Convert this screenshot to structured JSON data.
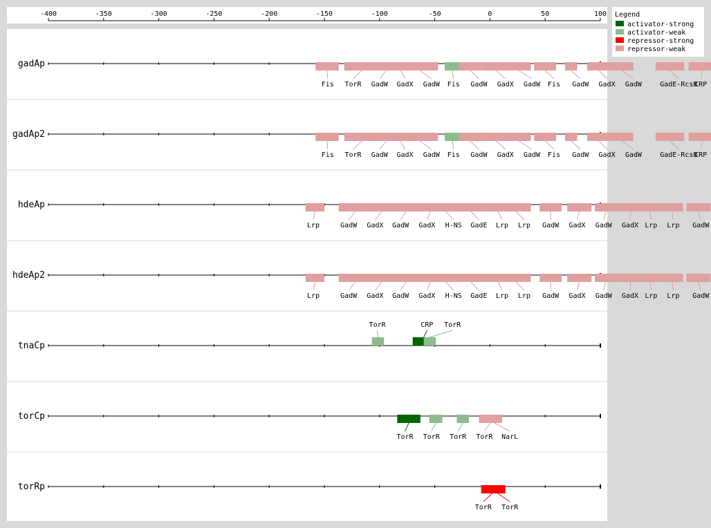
{
  "axis": {
    "min": -400,
    "max": 100,
    "ticks": [
      -400,
      -350,
      -300,
      -250,
      -200,
      -150,
      -100,
      -50,
      0,
      50,
      100
    ]
  },
  "legend": {
    "title": "Legend",
    "items": [
      {
        "label": "activator-strong",
        "color": "#006400"
      },
      {
        "label": "activator-weak",
        "color": "#8fbc8f"
      },
      {
        "label": "repressor-strong",
        "color": "#ff0000"
      },
      {
        "label": "repressor-weak",
        "color": "#e0a0a0"
      }
    ]
  },
  "colors": {
    "aw": "#8fbc8f",
    "as": "#006400",
    "rw": "#e0a0a0",
    "rs": "#ff0000"
  },
  "promoters": [
    {
      "name": "gadAp",
      "sites": [
        {
          "s": -158,
          "e": -137,
          "t": "rw",
          "l": "Fis",
          "p": -147
        },
        {
          "s": -132,
          "e": -100,
          "t": "rw",
          "l": "TorR",
          "p": -124
        },
        {
          "s": -103,
          "e": -85,
          "t": "rw",
          "l": "GadW",
          "p": -100
        },
        {
          "s": -92,
          "e": -70,
          "t": "rw",
          "l": "GadX",
          "p": -77
        },
        {
          "s": -80,
          "e": -47,
          "t": "rw",
          "l": "GadW",
          "p": -53
        },
        {
          "s": -41,
          "e": -27,
          "t": "aw",
          "l": "Fis",
          "p": -33
        },
        {
          "s": -28,
          "e": -8,
          "t": "rw",
          "l": "GadW",
          "p": -10
        },
        {
          "s": -8,
          "e": 19,
          "t": "rw",
          "l": "GadX",
          "p": 14
        },
        {
          "s": 15,
          "e": 37,
          "t": "rw",
          "l": "GadW",
          "p": 38
        },
        {
          "s": 40,
          "e": 60,
          "t": "rw",
          "l": "Fis",
          "p": 58
        },
        {
          "s": 68,
          "e": 79,
          "t": "rw",
          "l": "GadW",
          "p": 82
        },
        {
          "s": 88,
          "e": 110,
          "t": "rw",
          "l": "GadX",
          "p": 106
        },
        {
          "s": 110,
          "e": 130,
          "t": "rw",
          "l": "GadW",
          "p": 130
        },
        {
          "s": 150,
          "e": 176,
          "t": "rw",
          "l": "GadE-RcsB",
          "p": 171
        },
        {
          "s": 180,
          "e": 205,
          "t": "rw",
          "l": "CRP",
          "p": 191
        }
      ]
    },
    {
      "name": "gadAp2",
      "sites": [
        {
          "s": -158,
          "e": -137,
          "t": "rw",
          "l": "Fis",
          "p": -147
        },
        {
          "s": -132,
          "e": -100,
          "t": "rw",
          "l": "TorR",
          "p": -124
        },
        {
          "s": -103,
          "e": -85,
          "t": "rw",
          "l": "GadW",
          "p": -100
        },
        {
          "s": -92,
          "e": -70,
          "t": "rw",
          "l": "GadX",
          "p": -77
        },
        {
          "s": -80,
          "e": -47,
          "t": "rw",
          "l": "GadW",
          "p": -53
        },
        {
          "s": -41,
          "e": -27,
          "t": "aw",
          "l": "Fis",
          "p": -33
        },
        {
          "s": -28,
          "e": -8,
          "t": "rw",
          "l": "GadW",
          "p": -10
        },
        {
          "s": -8,
          "e": 19,
          "t": "rw",
          "l": "GadX",
          "p": 14
        },
        {
          "s": 15,
          "e": 37,
          "t": "rw",
          "l": "GadW",
          "p": 38
        },
        {
          "s": 40,
          "e": 60,
          "t": "rw",
          "l": "Fis",
          "p": 58
        },
        {
          "s": 68,
          "e": 79,
          "t": "rw",
          "l": "GadW",
          "p": 82
        },
        {
          "s": 88,
          "e": 110,
          "t": "rw",
          "l": "GadX",
          "p": 106
        },
        {
          "s": 110,
          "e": 130,
          "t": "rw",
          "l": "GadW",
          "p": 130
        },
        {
          "s": 150,
          "e": 176,
          "t": "rw",
          "l": "GadE-RcsB",
          "p": 171
        },
        {
          "s": 180,
          "e": 205,
          "t": "rw",
          "l": "CRP",
          "p": 191
        }
      ]
    },
    {
      "name": "hdeAp",
      "sites": [
        {
          "s": -167,
          "e": -150,
          "t": "rw",
          "l": "Lrp",
          "p": -160
        },
        {
          "s": -137,
          "e": -107,
          "t": "rw",
          "l": "GadW",
          "p": -128
        },
        {
          "s": -108,
          "e": -88,
          "t": "rw",
          "l": "GadX",
          "p": -104
        },
        {
          "s": -90,
          "e": -62,
          "t": "rw",
          "l": "GadW",
          "p": -81
        },
        {
          "s": -68,
          "e": -40,
          "t": "rw",
          "l": "GadX",
          "p": -57
        },
        {
          "s": -55,
          "e": -25,
          "t": "rw",
          "l": "H-NS",
          "p": -33
        },
        {
          "s": -30,
          "e": -5,
          "t": "rw",
          "l": "GadE",
          "p": -10
        },
        {
          "s": -5,
          "e": 20,
          "t": "rw",
          "l": "Lrp",
          "p": 11
        },
        {
          "s": 10,
          "e": 37,
          "t": "rw",
          "l": "Lrp",
          "p": 31
        },
        {
          "s": 45,
          "e": 65,
          "t": "rw",
          "l": "GadW",
          "p": 55
        },
        {
          "s": 70,
          "e": 92,
          "t": "rw",
          "l": "GadX",
          "p": 79
        },
        {
          "s": 95,
          "e": 115,
          "t": "rw",
          "l": "GadW",
          "p": 103
        },
        {
          "s": 115,
          "e": 140,
          "t": "rw",
          "l": "GadX",
          "p": 127
        },
        {
          "s": 135,
          "e": 155,
          "t": "rw",
          "l": "Lrp",
          "p": 146
        },
        {
          "s": 155,
          "e": 175,
          "t": "rw",
          "l": "Lrp",
          "p": 166
        },
        {
          "s": 178,
          "e": 200,
          "t": "rw",
          "l": "GadW",
          "p": 191
        }
      ]
    },
    {
      "name": "hdeAp2",
      "sites": [
        {
          "s": -167,
          "e": -150,
          "t": "rw",
          "l": "Lrp",
          "p": -160
        },
        {
          "s": -137,
          "e": -107,
          "t": "rw",
          "l": "GadW",
          "p": -128
        },
        {
          "s": -108,
          "e": -88,
          "t": "rw",
          "l": "GadX",
          "p": -104
        },
        {
          "s": -90,
          "e": -62,
          "t": "rw",
          "l": "GadW",
          "p": -81
        },
        {
          "s": -68,
          "e": -40,
          "t": "rw",
          "l": "GadX",
          "p": -57
        },
        {
          "s": -55,
          "e": -25,
          "t": "rw",
          "l": "H-NS",
          "p": -33
        },
        {
          "s": -30,
          "e": -5,
          "t": "rw",
          "l": "GadE",
          "p": -10
        },
        {
          "s": -5,
          "e": 20,
          "t": "rw",
          "l": "Lrp",
          "p": 11
        },
        {
          "s": 10,
          "e": 37,
          "t": "rw",
          "l": "Lrp",
          "p": 31
        },
        {
          "s": 45,
          "e": 65,
          "t": "rw",
          "l": "GadW",
          "p": 55
        },
        {
          "s": 70,
          "e": 92,
          "t": "rw",
          "l": "GadX",
          "p": 79
        },
        {
          "s": 95,
          "e": 115,
          "t": "rw",
          "l": "GadW",
          "p": 103
        },
        {
          "s": 115,
          "e": 140,
          "t": "rw",
          "l": "GadX",
          "p": 127
        },
        {
          "s": 135,
          "e": 155,
          "t": "rw",
          "l": "Lrp",
          "p": 146
        },
        {
          "s": 155,
          "e": 175,
          "t": "rw",
          "l": "Lrp",
          "p": 166
        },
        {
          "s": 178,
          "e": 200,
          "t": "rw",
          "l": "GadW",
          "p": 191
        }
      ]
    },
    {
      "name": "tnaCp",
      "sites": [
        {
          "s": -107,
          "e": -96,
          "t": "aw",
          "l": "TorR",
          "p": -102
        },
        {
          "s": -70,
          "e": -50,
          "t": "as",
          "l": "CRP",
          "p": -57
        },
        {
          "s": -60,
          "e": -49,
          "t": "aw",
          "l": "TorR",
          "p": -34
        }
      ]
    },
    {
      "name": "torCp",
      "sites": [
        {
          "s": -84,
          "e": -63,
          "t": "as",
          "l": "TorR",
          "p": -77
        },
        {
          "s": -55,
          "e": -43,
          "t": "aw",
          "l": "TorR",
          "p": -53
        },
        {
          "s": -30,
          "e": -19,
          "t": "aw",
          "l": "TorR",
          "p": -29
        },
        {
          "s": -10,
          "e": 11,
          "t": "rw",
          "l": "TorR",
          "p": -5
        },
        {
          "s": -3,
          "e": 11,
          "t": "rw",
          "l": "NarL",
          "p": 18
        }
      ]
    },
    {
      "name": "torRp",
      "sites": [
        {
          "s": -8,
          "e": 12,
          "t": "rs",
          "l": "TorR",
          "p": -6
        },
        {
          "s": 0,
          "e": 14,
          "t": "rs",
          "l": "TorR",
          "p": 18
        }
      ]
    }
  ]
}
